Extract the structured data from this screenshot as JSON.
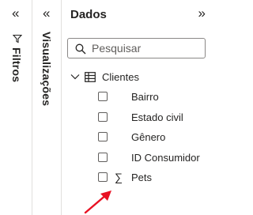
{
  "filters_pane": {
    "title": "Filtros",
    "collapse_glyph": "«"
  },
  "viz_pane": {
    "title": "Visualizações",
    "collapse_glyph": "«"
  },
  "data_pane": {
    "title": "Dados",
    "expand_glyph": "»",
    "search": {
      "placeholder": "Pesquisar",
      "value": ""
    },
    "table": {
      "name": "Clientes",
      "expanded": true,
      "fields": [
        {
          "label": "Bairro",
          "icon": "none"
        },
        {
          "label": "Estado civil",
          "icon": "none"
        },
        {
          "label": "Gênero",
          "icon": "none"
        },
        {
          "label": "ID Consumidor",
          "icon": "none"
        },
        {
          "label": "Pets",
          "icon": "sigma",
          "icon_glyph": "∑"
        }
      ]
    }
  },
  "annotation": {
    "color": "#e81123",
    "shape": "arrow"
  }
}
